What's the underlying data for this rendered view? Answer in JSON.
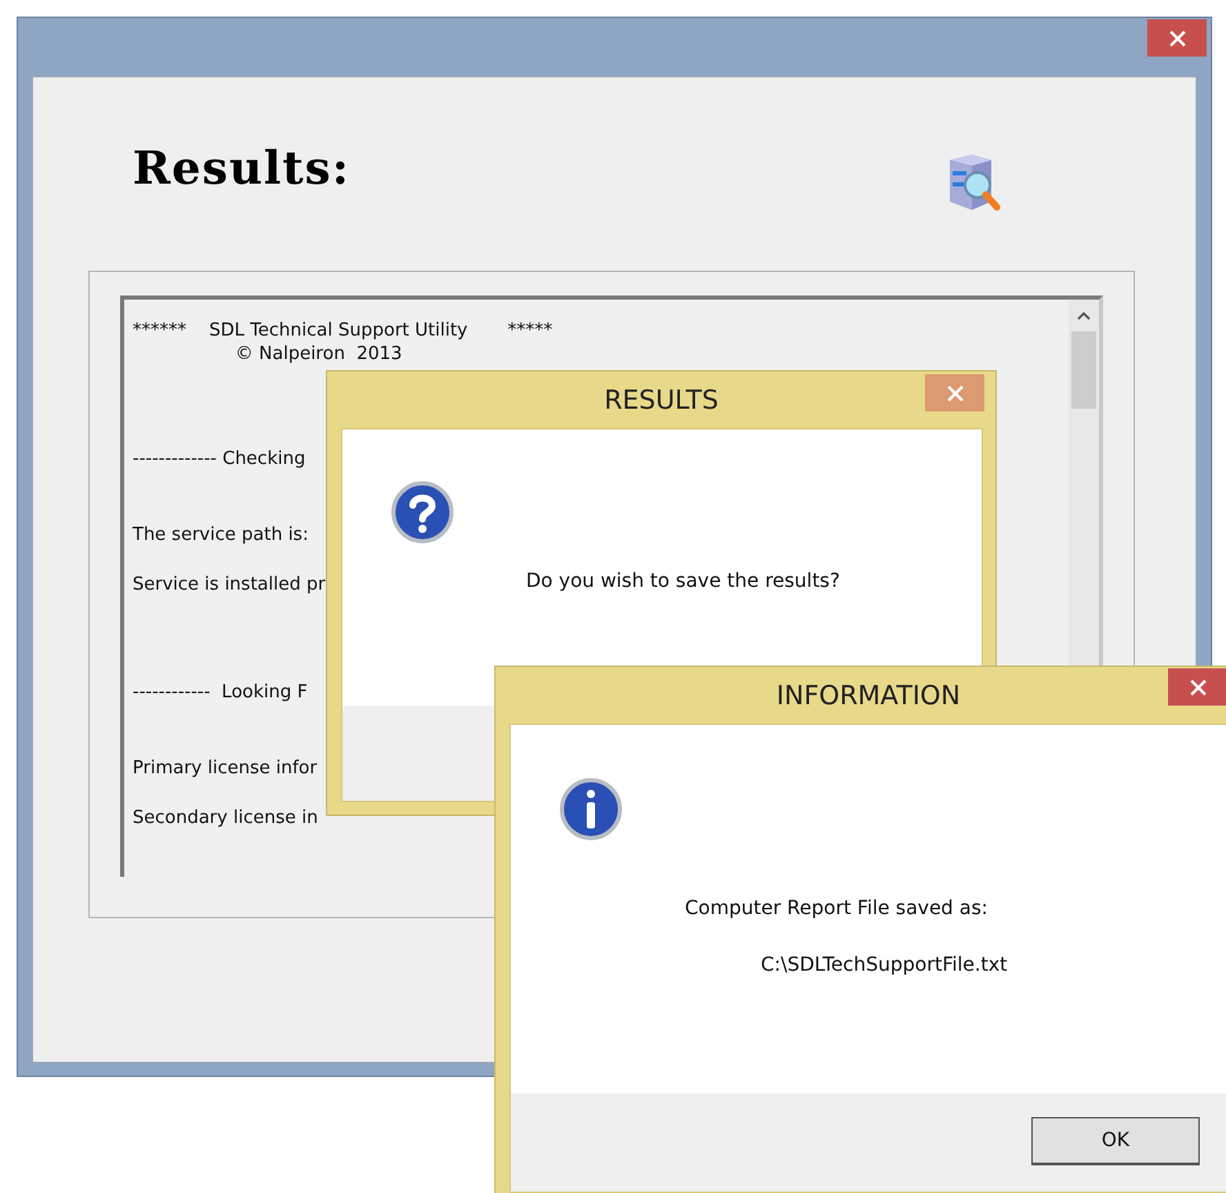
{
  "main_window": {
    "heading": "Results:",
    "log_lines": [
      {
        "kind": "title",
        "text": "******    SDL Technical Support Utility       *****"
      },
      {
        "kind": "title",
        "text": "                  © Nalpeiron  2013"
      },
      {
        "kind": "section",
        "text": "------------- Checking"
      },
      {
        "kind": "item",
        "text": "The service path is:"
      },
      {
        "kind": "item",
        "text": "Service is installed pr"
      },
      {
        "kind": "section",
        "text": "------------  Looking F"
      },
      {
        "kind": "item",
        "text": "Primary license infor"
      },
      {
        "kind": "item",
        "text": "Secondary license in"
      }
    ]
  },
  "results_dialog": {
    "title": "RESULTS",
    "active": false,
    "message": "Do you wish to save the results?"
  },
  "info_dialog": {
    "title": "INFORMATION",
    "active": true,
    "message": "Computer Report File saved as:",
    "path": "C:\\SDLTechSupportFile.txt",
    "buttons": [
      "OK"
    ]
  }
}
